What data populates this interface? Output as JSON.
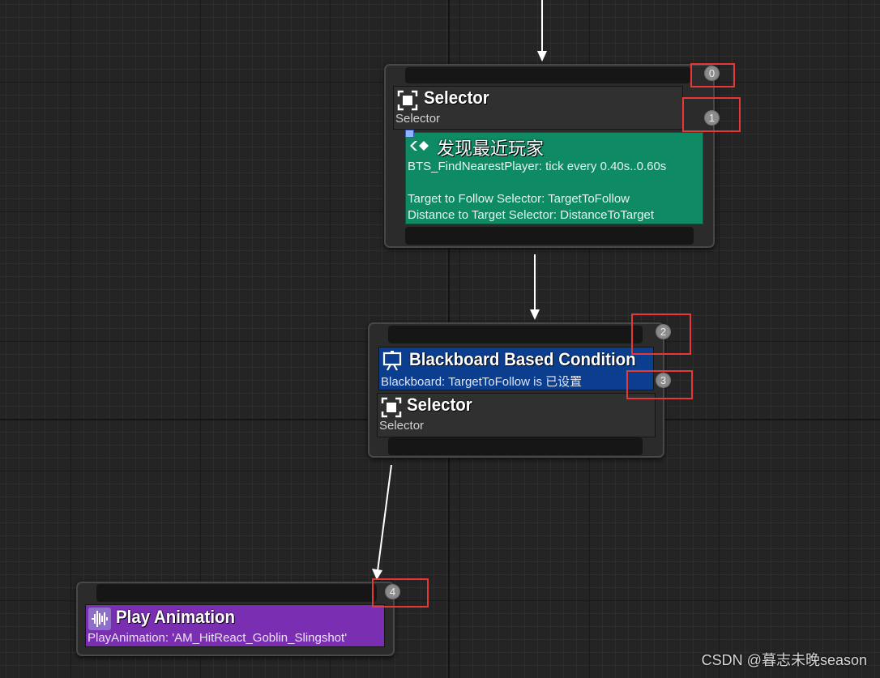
{
  "nodes": {
    "selector_root": {
      "title": "Selector",
      "subtitle": "Selector",
      "index_top": "0",
      "index_bottom": "1",
      "service": {
        "title": "发现最近玩家",
        "line1": "BTS_FindNearestPlayer: tick every 0.40s..0.60s",
        "line2": "Target to Follow Selector: TargetToFollow",
        "line3": "Distance to Target Selector: DistanceToTarget"
      }
    },
    "condition": {
      "title": "Blackboard Based Condition",
      "subtitle": "Blackboard: TargetToFollow is 已设置",
      "index_top": "2",
      "index_decorator": "3",
      "inner_title": "Selector",
      "inner_subtitle": "Selector"
    },
    "play_animation": {
      "title": "Play Animation",
      "subtitle": "PlayAnimation: 'AM_HitReact_Goblin_Slingshot'",
      "index": "4"
    }
  },
  "watermark": "CSDN @暮志未晚season",
  "colors": {
    "graph_bg": "#242424",
    "service_green": "#0e8a64",
    "decorator_blue": "#0b3e8f",
    "task_purple": "#7a2fb3",
    "highlight_red": "#e53935"
  },
  "icons": [
    "selector-icon",
    "service-icon",
    "blackboard-icon",
    "animation-icon"
  ]
}
